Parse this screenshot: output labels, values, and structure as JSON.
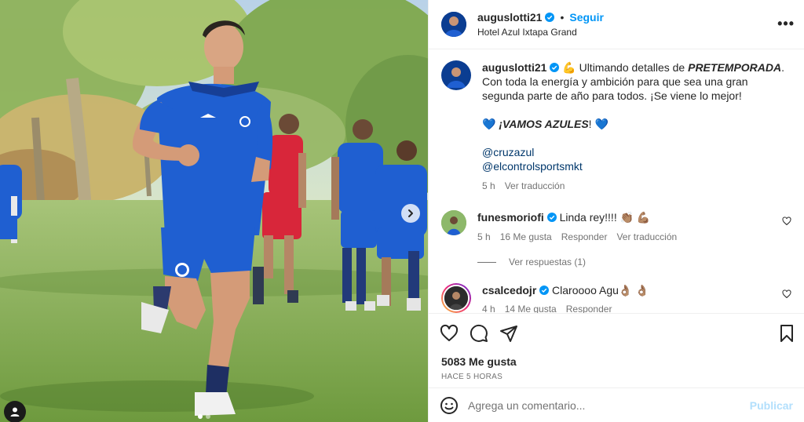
{
  "post": {
    "author": "auguslotti21",
    "follow_label": "Seguir",
    "separator": "•",
    "location": "Hotel Azul Ixtapa Grand",
    "more_label": "•••"
  },
  "caption": {
    "username": "auguslotti21",
    "emoji": "💪",
    "line1_prefix": "Ultimando detalles de",
    "line1_bold": "PRETEMPORADA",
    "line1_suffix": ".",
    "line2": "Con toda la energía y ambición para que sea una gran segunda parte de año para todos. ¡Se viene lo mejor!",
    "hearts": "💙",
    "vamos": "¡VAMOS AZULES",
    "vamos_end": "!",
    "mentions": [
      "@cruzazul",
      "@elcontrolsportsmkt"
    ],
    "time": "5 h",
    "translate": "Ver traducción"
  },
  "comments": [
    {
      "username": "funesmoriofi",
      "text": "Linda rey!!!! 👏🏽 💪🏽",
      "time": "5 h",
      "likes": "16 Me gusta",
      "reply": "Responder",
      "translate": "Ver traducción",
      "view_replies": "Ver respuestas (1)"
    },
    {
      "username": "csalcedojr",
      "text": "Claroooo Agu👌🏽 👌🏽",
      "time": "4 h",
      "likes": "14 Me gusta",
      "reply": "Responder"
    }
  ],
  "likes": {
    "count": "5083 Me gusta",
    "when": "HACE 5 HORAS"
  },
  "add_comment": {
    "placeholder": "Agrega un comentario...",
    "publish": "Publicar",
    "emoji_icon": "smiley-icon"
  },
  "colors": {
    "accent": "#0095f6",
    "verified": "#0095f6",
    "jersey": "#1f5fd1",
    "red_jersey": "#d8263a"
  }
}
